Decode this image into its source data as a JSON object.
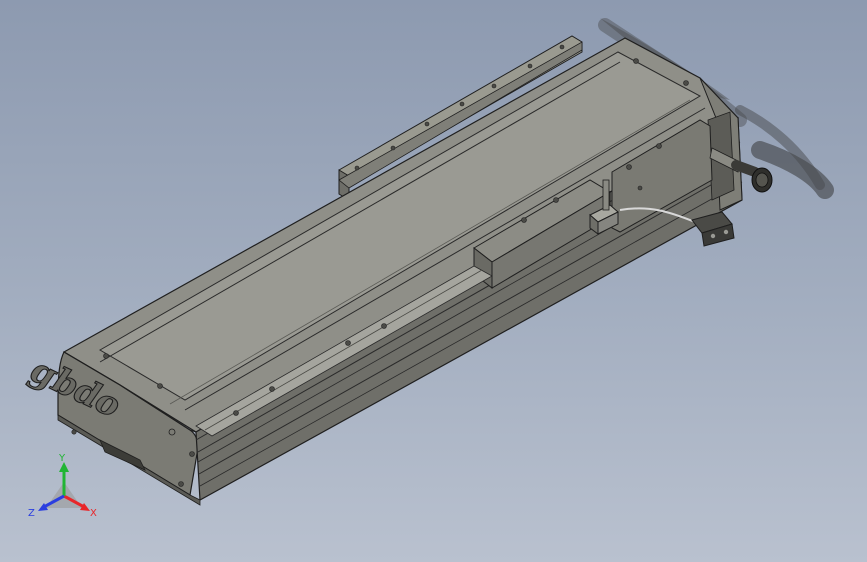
{
  "model": {
    "logo_text": "gbdo"
  },
  "triad": {
    "x_label": "X",
    "y_label": "Y",
    "z_label": "Z",
    "x_color": "#e8262a",
    "y_color": "#21b534",
    "z_color": "#2a3ee0"
  },
  "colors": {
    "viewport_top": "#8d9ab0",
    "viewport_bottom": "#b9c1cf",
    "body_gray": "#8e8e86",
    "body_dark": "#4c4c48",
    "edge": "#1f1f1f"
  }
}
